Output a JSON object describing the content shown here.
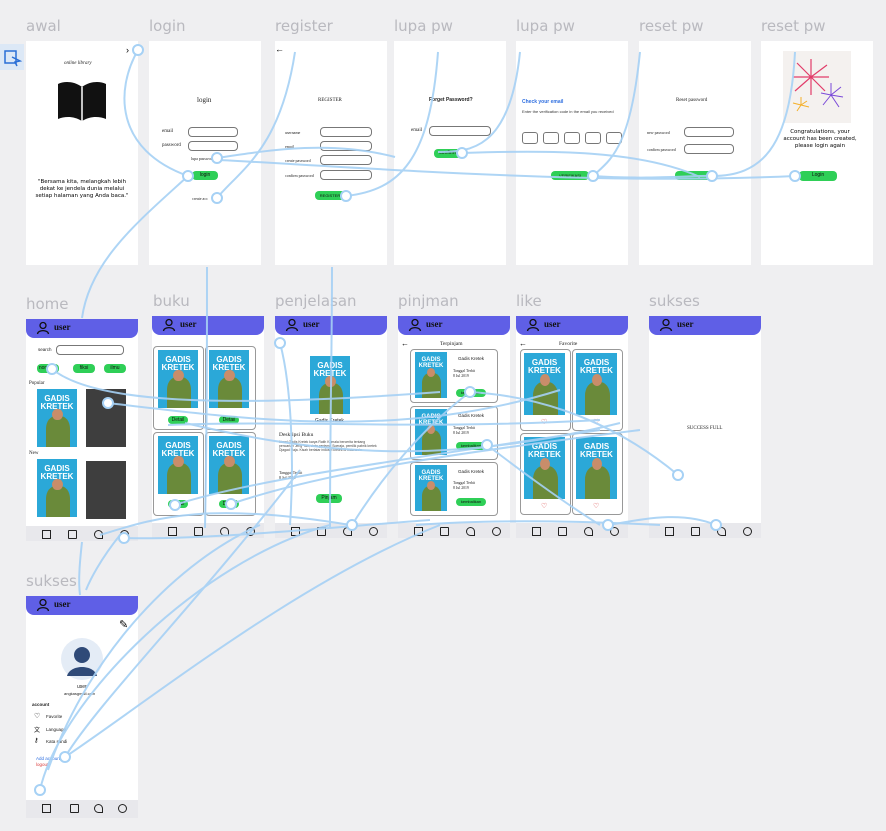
{
  "labels": {
    "awal": "awal",
    "login": "login",
    "register": "register",
    "lupa1": "lupa pw",
    "lupa2": "lupa pw",
    "reset1": "reset pw",
    "reset2": "reset pw",
    "home": "home",
    "buku": "buku",
    "penjelasan": "penjelasan",
    "pinjman": "pinjman",
    "like": "like",
    "sukses1": "sukses",
    "sukses2": "sukses"
  },
  "toolbar": {
    "icon": "present-icon"
  },
  "awal": {
    "title": "online library",
    "quote": "\"Bersama kita, melangkah lebih dekat ke jendela dunia melalui setiap halaman yang Anda baca.\""
  },
  "login": {
    "title": "login",
    "email_label": "email",
    "password_label": "password",
    "forgot": "lupa password",
    "button": "login",
    "register_link": "create acc"
  },
  "register": {
    "title": "REGISTER",
    "username": "username",
    "email": "email",
    "password": "create password",
    "confirm": "confirm password",
    "button": "REGISTER"
  },
  "lupa1": {
    "title": "Forget Password?",
    "email_label": "email",
    "button": "confirm"
  },
  "lupa2": {
    "title": "Check your email",
    "desc": "Enter the verification code in the email you received",
    "button": "VERIFIKASI"
  },
  "reset1": {
    "title": "Reset password",
    "new": "new password",
    "confirm": "confirm password"
  },
  "reset2": {
    "message": "Congratulations, your account has been created, please login again",
    "button": "Login"
  },
  "user_header": "user",
  "home": {
    "search_label": "search",
    "chips": [
      "non fiksi",
      "fiksi",
      "ilmu"
    ],
    "popular": "Popular",
    "new": "New"
  },
  "book": {
    "title_line1": "GADIS",
    "title_line2": "KRETEK",
    "name": "Gadis Kretek"
  },
  "buku": {
    "detail_button": "Detail"
  },
  "penjelasan": {
    "book_name": "Gadis Kretek",
    "desc_title": "Deskripsi Buku",
    "desc_text": "Novel Gadis Kretek karya Ratih Kumala bercerita tentang pencarian Jeng Yah, cinta pertama Soeraja, pemilik pabrik kretek Djagad Raja. Kisah berlatar industri kretek di Indonesia.",
    "tanggal": "Tanggal Terbit",
    "tanggal_val": "8 Jul 2019",
    "button": "Pinjam"
  },
  "pinjman": {
    "title": "Terpinjam",
    "items": [
      {
        "name": "Gadis Kretek",
        "date_label": "Tanggal Terbit",
        "date": "8 Jul 2019",
        "button": "kembalikan"
      },
      {
        "name": "Gadis Kretek",
        "date_label": "Tanggal Terbit",
        "date": "8 Jul 2019",
        "button": "kembalikan"
      },
      {
        "name": "Gadis Kretek",
        "date_label": "Tanggal Terbit",
        "date": "8 Jul 2019",
        "button": "kembalikan"
      }
    ]
  },
  "like": {
    "title": "Favorite"
  },
  "sukses1": {
    "message": "SUCCESS FULL"
  },
  "profile": {
    "name": "user",
    "email": "angkasgmail.com",
    "section": "account",
    "items": [
      "Favorite",
      "Language",
      "Kata sandi"
    ],
    "add": "Add account",
    "logout": "logout"
  }
}
